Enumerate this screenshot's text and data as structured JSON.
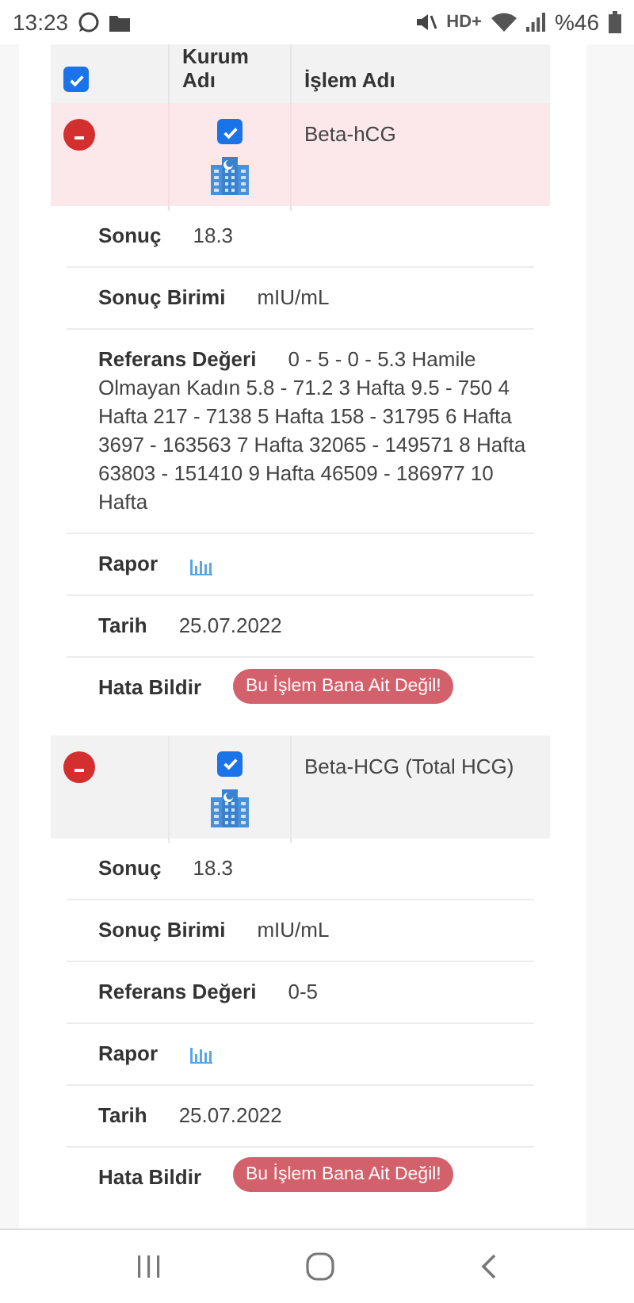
{
  "status_bar": {
    "time": "13:23",
    "network": "HD+",
    "battery": "%46"
  },
  "table": {
    "select_all": {
      "checked": true
    },
    "columns": [
      "Kurum Adı",
      "İşlem Adı"
    ],
    "rows": [
      {
        "highlighted": true,
        "checked": true,
        "name": "Beta-hCG",
        "details": [
          {
            "kind": "text",
            "label": "Sonuç",
            "value": "18.3"
          },
          {
            "kind": "text",
            "label": "Sonuç Birimi",
            "value": "mIU/mL"
          },
          {
            "kind": "text",
            "label": "Referans Değeri",
            "value": "0 - 5 - 0 - 5.3 Hamile Olmayan Kadın 5.8 - 71.2 3 Hafta 9.5 - 750 4 Hafta 217 - 7138 5 Hafta 158 - 31795 6 Hafta 3697 - 163563 7 Hafta 32065 - 149571 8 Hafta 63803 - 151410 9 Hafta 46509 - 186977 10 Hafta"
          },
          {
            "kind": "report",
            "label": "Rapor"
          },
          {
            "kind": "text",
            "label": "Tarih",
            "value": "25.07.2022"
          },
          {
            "kind": "button",
            "label": "Hata Bildir",
            "value": "Bu İşlem Bana Ait Değil!"
          }
        ]
      },
      {
        "highlighted": false,
        "checked": true,
        "name": "Beta-HCG (Total HCG)",
        "details": [
          {
            "kind": "text",
            "label": "Sonuç",
            "value": "18.3"
          },
          {
            "kind": "text",
            "label": "Sonuç Birimi",
            "value": "mIU/mL"
          },
          {
            "kind": "text",
            "label": "Referans Değeri",
            "value": "0-5"
          },
          {
            "kind": "report",
            "label": "Rapor"
          },
          {
            "kind": "text",
            "label": "Tarih",
            "value": "25.07.2022"
          },
          {
            "kind": "button",
            "label": "Hata Bildir",
            "value": "Bu İşlem Bana Ait Değil!"
          }
        ]
      }
    ]
  }
}
